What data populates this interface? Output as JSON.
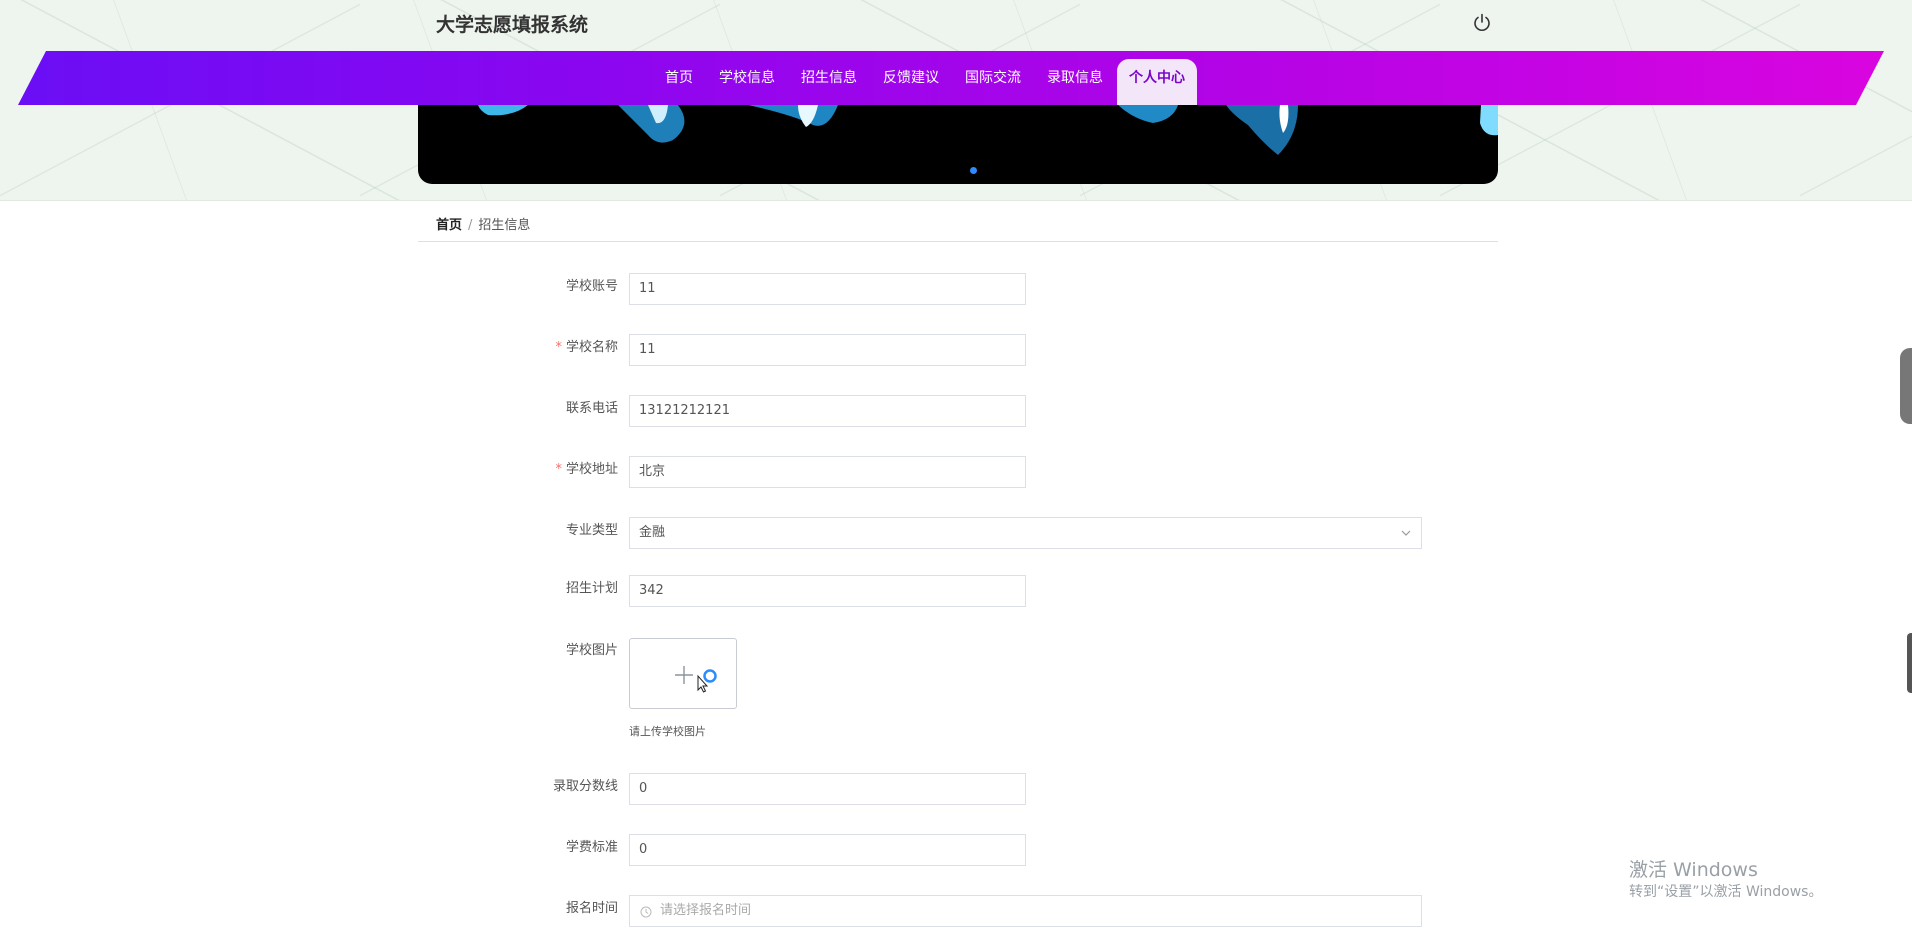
{
  "header": {
    "site_title": "大学志愿填报系统",
    "power_icon": "power-icon"
  },
  "nav": {
    "items": [
      {
        "label": "首页"
      },
      {
        "label": "学校信息"
      },
      {
        "label": "招生信息"
      },
      {
        "label": "反馈建议"
      },
      {
        "label": "国际交流"
      },
      {
        "label": "录取信息"
      },
      {
        "label": "个人中心"
      }
    ],
    "active_index": 6,
    "gradient_colors": [
      "#6b0ef5",
      "#d905e0"
    ]
  },
  "breadcrumb": {
    "home": "首页",
    "separator": "/",
    "current": "招生信息"
  },
  "form": {
    "school_account": {
      "label": "学校账号",
      "value": "11"
    },
    "school_name": {
      "label": "学校名称",
      "value": "11",
      "required": true
    },
    "phone": {
      "label": "联系电话",
      "value": "13121212121"
    },
    "address": {
      "label": "学校地址",
      "value": "北京",
      "required": true
    },
    "major_type": {
      "label": "专业类型",
      "value": "金融"
    },
    "enroll_plan": {
      "label": "招生计划",
      "value": "342"
    },
    "school_image": {
      "label": "学校图片",
      "tip": "请上传学校图片"
    },
    "score_line": {
      "label": "录取分数线",
      "value": "0"
    },
    "tuition": {
      "label": "学费标准",
      "value": "0"
    },
    "signup_time": {
      "label": "报名时间",
      "placeholder": "请选择报名时间"
    },
    "required_mark": "*"
  },
  "watermark": {
    "line1": "激活 Windows",
    "line2": "转到“设置”以激活 Windows。"
  }
}
